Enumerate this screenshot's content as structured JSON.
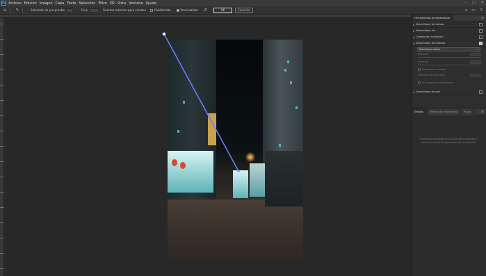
{
  "menubar": {
    "app_icon": "Ps",
    "items": [
      "Archivo",
      "Edición",
      "Imagen",
      "Capa",
      "Texto",
      "Selección",
      "Filtro",
      "3D",
      "Vista",
      "Ventana",
      "Ayuda"
    ],
    "window_controls": [
      "minimize-icon",
      "maximize-icon",
      "close-icon"
    ]
  },
  "optionsbar": {
    "selection_label": "Selección de pre-prueba",
    "focus_label": "Foco",
    "save_mask_label": "Guardar máscara para canales",
    "high_quality_label": "Calidad alta",
    "preview_label": "Previsualizar",
    "high_quality_checked": false,
    "preview_checked": true,
    "ok_label": "OK",
    "cancel_label": "Cancelar"
  },
  "right_panel": {
    "title": "Herramientas de desenfoque",
    "sections": [
      {
        "label": "Desenfoque de campo",
        "expanded": false,
        "checked": false
      },
      {
        "label": "Desenfoque iris",
        "expanded": false,
        "checked": false
      },
      {
        "label": "Cambio de inclinación",
        "expanded": false,
        "checked": false
      },
      {
        "label": "Desenfoque de trazado",
        "expanded": true,
        "checked": true
      }
    ],
    "path_blur": {
      "mode_value": "Desenfoque básico",
      "params": [
        "Velocidad",
        "Estrechar"
      ],
      "checks": [
        "Desenfoque centrado",
        "Ver trazados de desenfoque"
      ],
      "end_speed_label": "Velocidad de punto final"
    },
    "spin_section": {
      "label": "Desenfoque de giro",
      "checked": false
    },
    "lower_tabs": [
      "Efectos",
      "Efectos de movimiento",
      "Ruido"
    ],
    "empty_message": "Desenfoque de campo en el lienzo para comenzar a editar los efectos de desenfoque de movimiento."
  }
}
